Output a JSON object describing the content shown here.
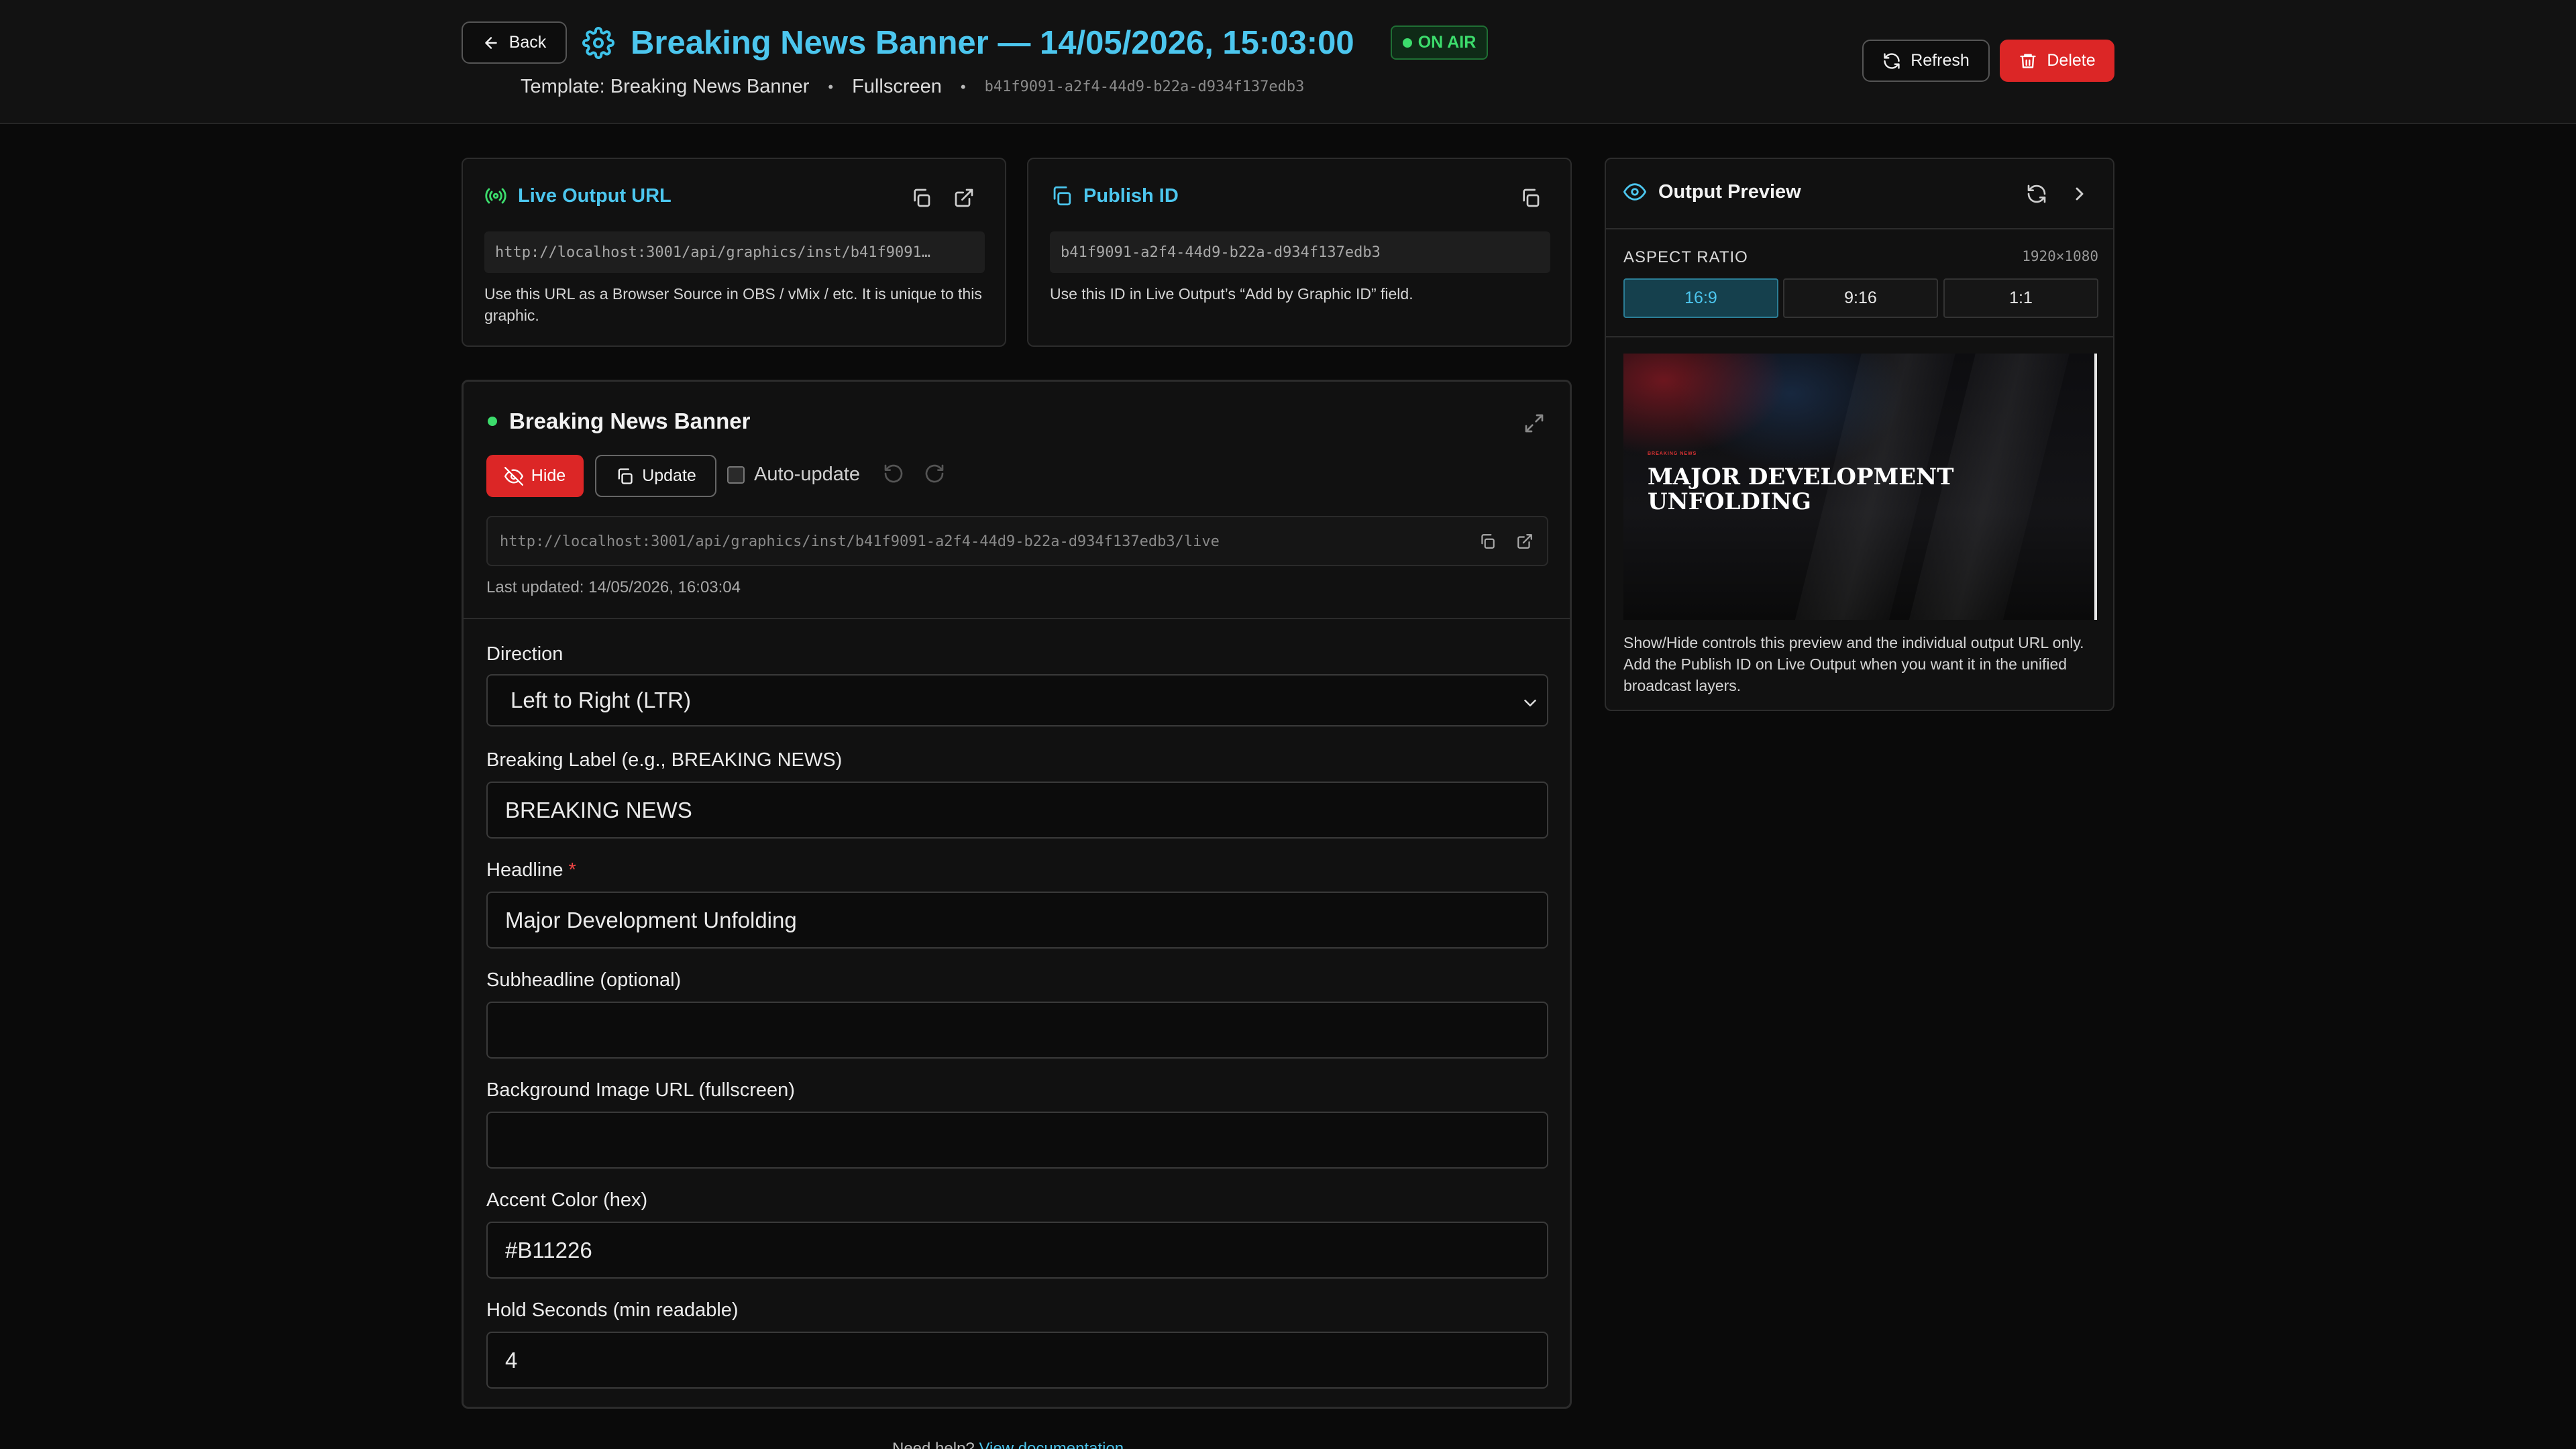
{
  "header": {
    "back_label": "Back",
    "title": "Breaking News Banner — 14/05/2026, 15:03:00",
    "status_badge": "ON AIR",
    "template": "Template: Breaking News Banner",
    "mode": "Fullscreen",
    "id": "b41f9091-a2f4-44d9-b22a-d934f137edb3",
    "sep": "•",
    "refresh_label": "Refresh",
    "delete_label": "Delete"
  },
  "live_output": {
    "title": "Live Output URL",
    "url": "http://localhost:3001/api/graphics/inst/b41f9091…",
    "help": "Use this URL as a Browser Source in OBS / vMix / etc. It is unique to this graphic."
  },
  "publish": {
    "title": "Publish ID",
    "id": "b41f9091-a2f4-44d9-b22a-d934f137edb3",
    "help": "Use this ID in Live Output’s “Add by Graphic ID” field."
  },
  "editor": {
    "title": "Breaking News Banner",
    "hide_label": "Hide",
    "update_label": "Update",
    "auto_update_label": "Auto-update",
    "auto_update_checked": false,
    "live_url": "http://localhost:3001/api/graphics/inst/b41f9091-a2f4-44d9-b22a-d934f137edb3/live",
    "last_updated": "Last updated: 14/05/2026, 16:03:04",
    "fields": {
      "direction": {
        "label": "Direction",
        "value": "Left to Right (LTR)"
      },
      "breaking_label": {
        "label": "Breaking Label (e.g., BREAKING NEWS)",
        "value": "BREAKING NEWS"
      },
      "headline": {
        "label": "Headline",
        "required_mark": "*",
        "value": "Major Development Unfolding"
      },
      "subheadline": {
        "label": "Subheadline (optional)",
        "value": ""
      },
      "background": {
        "label": "Background Image URL (fullscreen)",
        "value": ""
      },
      "accent": {
        "label": "Accent Color (hex)",
        "value": "#B11226"
      },
      "hold": {
        "label": "Hold Seconds (min readable)",
        "value": "4"
      }
    }
  },
  "preview": {
    "title": "Output Preview",
    "aspect_label": "ASPECT RATIO",
    "resolution": "1920×1080",
    "ratios": [
      "16:9",
      "9:16",
      "1:1"
    ],
    "active_ratio": "16:9",
    "canvas_label": "BREAKING NEWS",
    "canvas_headline": "Major Development Unfolding",
    "help": "Show/Hide controls this preview and the individual output URL only. Add the Publish ID on Live Output when you want it in the unified broadcast layers."
  },
  "footer_fragment": {
    "text": "Need help? ",
    "link": "View documentation"
  },
  "colors": {
    "accent": "#4cc6ee",
    "danger": "#dc2626",
    "live": "#3cdc6c",
    "brand_red": "#B11226"
  }
}
